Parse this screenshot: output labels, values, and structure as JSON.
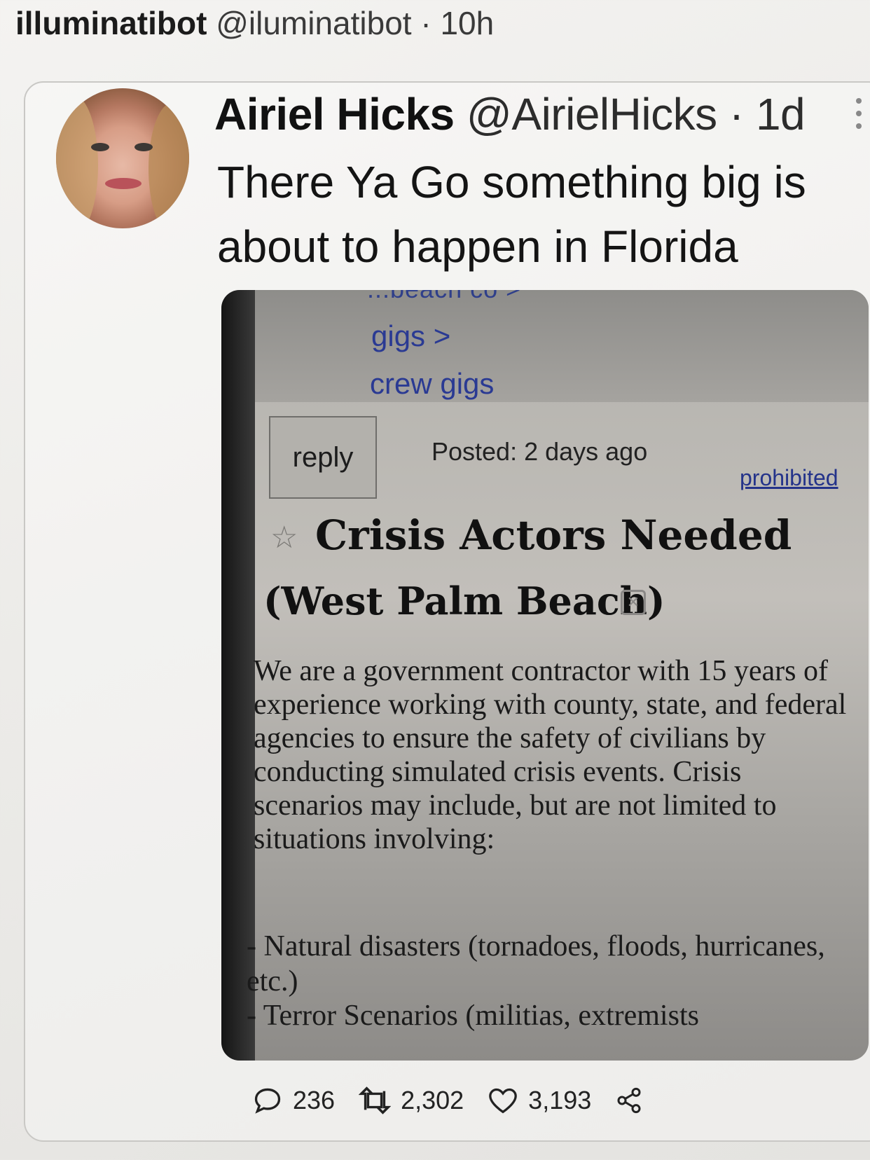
{
  "outer_tweet": {
    "author_name": "illuminatibot",
    "author_handle": "@iluminatibot",
    "separator": "·",
    "time": "10h"
  },
  "quoted_tweet": {
    "author_name": "Airiel Hicks",
    "author_handle": "@AirielHicks",
    "separator": "·",
    "time": "1d",
    "text": "There Ya Go something big is about to happen in Florida"
  },
  "screenshot": {
    "breadcrumb_partial": "...beach co >",
    "breadcrumb_gigs": "gigs >",
    "breadcrumb_crew": "crew gigs",
    "reply_label": "reply",
    "posted_text": "Posted: 2 days ago",
    "prohibited_link": "prohibited",
    "title": "Crisis Actors Needed",
    "location": "(West Palm Beach)",
    "body": "We are a government contractor with 15 years of experience working with county, state, and federal agencies to ensure the safety of civilians by conducting simulated crisis events. Crisis scenarios may include, but are not limited to situations involving:",
    "list_item_1": "- Natural disasters (tornadoes, floods, hurricanes, etc.)",
    "list_item_2": "- Terror Scenarios (militias, extremists"
  },
  "actions": {
    "replies": "236",
    "retweets": "2,302",
    "likes": "3,193"
  },
  "icons": [
    "reply-icon",
    "retweet-icon",
    "like-icon",
    "share-icon",
    "more-icon",
    "star-icon",
    "flag-icon"
  ]
}
